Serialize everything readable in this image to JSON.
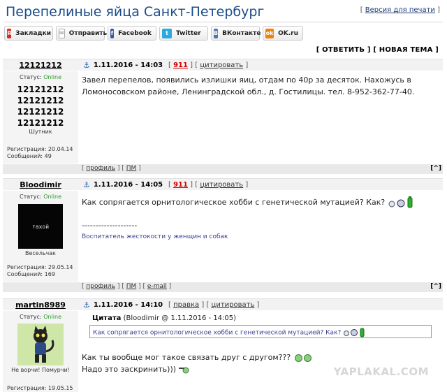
{
  "page": {
    "title": "Перепелиные яйца Санкт-Петербург",
    "print_link": "Версия для печати"
  },
  "share": [
    {
      "label": "Закладки",
      "icon": "yandex-bookmarks-icon",
      "icon_text": "Я",
      "color": "#d62b20"
    },
    {
      "label": "Отправить",
      "icon": "mail-icon",
      "icon_text": "✉",
      "color": "#9a9a9a"
    },
    {
      "label": "Facebook",
      "icon": "facebook-icon",
      "icon_text": "f",
      "color": "#3b5998"
    },
    {
      "label": "Twitter",
      "icon": "twitter-icon",
      "icon_text": "t",
      "color": "#2aa9e0"
    },
    {
      "label": "ВКонтакте",
      "icon": "vk-icon",
      "icon_text": "B",
      "color": "#4a76a8"
    },
    {
      "label": "OK.ru",
      "icon": "ok-icon",
      "icon_text": "ok",
      "color": "#ee8208"
    }
  ],
  "actions": {
    "reply": "ОТВЕТИТЬ",
    "new_topic": "НОВАЯ ТЕМА"
  },
  "posts": [
    {
      "author": "12121212",
      "date": "1.11.2016 - 14:03",
      "number": "911",
      "quote_link": "цитировать",
      "status_label": "Статус:",
      "status_value": "Online",
      "nick_lines": [
        "12121212",
        "12121212",
        "12121212",
        "12121212"
      ],
      "rank": "Шутник",
      "reg": "Регистрация: 20.04.14",
      "msgs": "Сообщений: 49",
      "text": "Завел перепелов, появились излишки яиц, отдам по 40р за десяток. Нахожусь в Ломоносовском районе, Ленинградской обл., д. Гостилицы. тел. 8-952-362-77-40.",
      "foot_links": [
        "профиль",
        "ПМ"
      ]
    },
    {
      "author": "Bloodimir",
      "date": "1.11.2016 - 14:05",
      "number": "911",
      "quote_link": "цитировать",
      "status_label": "Статус:",
      "status_value": "Online",
      "avatar_text": "тахой",
      "rank": "Весельчак",
      "reg": "Регистрация: 29.05.14",
      "msgs": "Сообщений: 169",
      "text": "Как сопрягается орнитологическое хобби с генетической мутацией? Как?",
      "sig_line": "--------------------",
      "signature": "Воспитатель жестокости у женщин и собак",
      "foot_links": [
        "профиль",
        "ПМ",
        "e-mail"
      ]
    },
    {
      "author": "martin8989",
      "date": "1.11.2016 - 14:10",
      "edit_link": "правка",
      "quote_link": "цитировать",
      "status_label": "Статус:",
      "status_value": "Online",
      "rank": "Не ворчи! Помурчи!",
      "reg": "Регистрация: 19.05.15",
      "quote_label": "Цитата",
      "quote_meta": "(Bloodimir @ 1.11.2016 - 14:05)",
      "quote_text": "Как сопрягается орнитологическое хобби с генетической мутацией? Как?",
      "text_1": "Как ты вообще мог такое связать друг с другом???",
      "text_2": "Надо это заскринить)))"
    }
  ],
  "up_label": "[^]",
  "watermark": "YAPLAKAL.COM"
}
